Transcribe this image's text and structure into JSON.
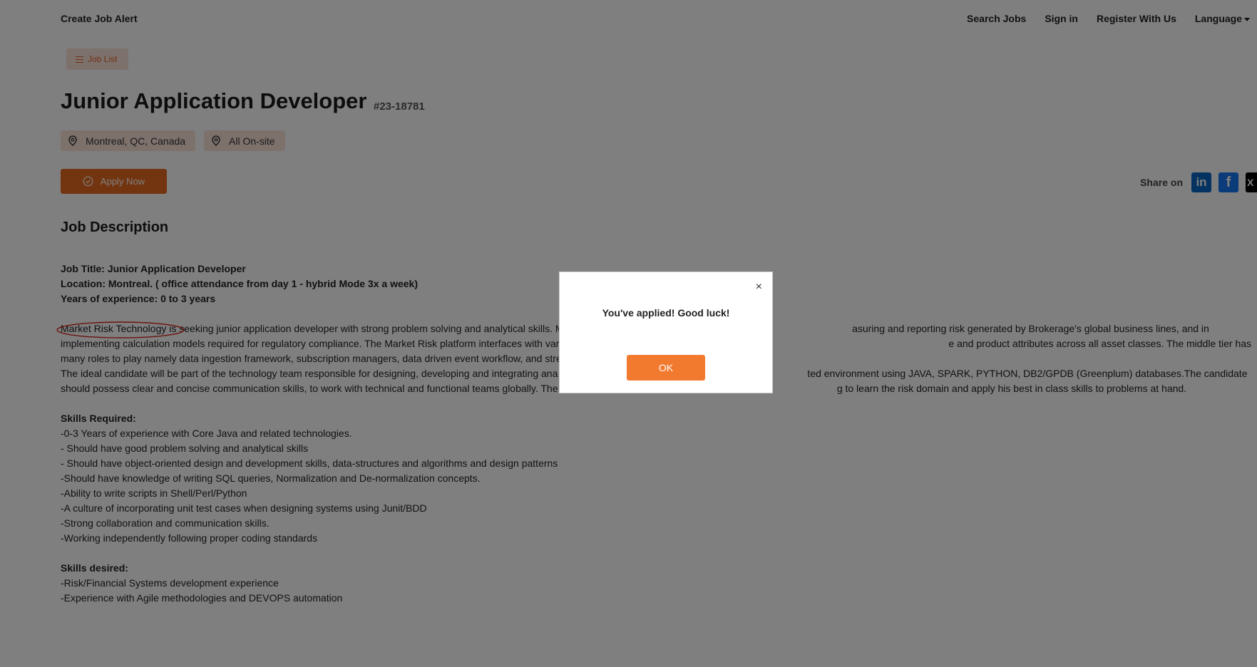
{
  "nav": {
    "create_alert": "Create Job Alert",
    "items": [
      "Search Jobs",
      "Sign in",
      "Register With Us",
      "Language"
    ]
  },
  "job_list_label": "Job List",
  "job": {
    "title": "Junior Application Developer",
    "id": "#23-18781",
    "location": "Montreal, QC, Canada",
    "work_mode": "All On-site",
    "apply_label": "Apply Now"
  },
  "share_label": "Share on",
  "social": {
    "linkedin": "in",
    "facebook": "f",
    "x": "X"
  },
  "section_title": "Job Description",
  "description": {
    "title_line": "Job Title: Junior Application Developer",
    "location_line": "Location: Montreal. ( office attendance from day 1 - hybrid Mode 3x a week)",
    "experience_line": "Years of experience: 0 to 3 years",
    "para1_circled": "Market Risk Technology",
    "para1_rest": " is seeking junior application developer with strong problem solving and analytical skills. M                                                                                                        asuring and reporting risk generated by Brokerage's global business lines, and in implementing calculation models required for regulatory compliance. The Market Risk platform interfaces with various systems and obtains                                                                                                    e and product attributes across all asset classes. The middle tier has many roles to play namely data ingestion framework, subscription managers, data driven event workflow, and streaming dynamic datasets over the wire.",
    "para2": "The ideal candidate will be part of the technology team responsible for designing, developing and integrating ana                                                                                          ted environment using JAVA, SPARK, PYTHON, DB2/GPDB (Greenplum) databases.The candidate should possess clear and concise communication skills, to work with technical and functional teams globally. The candid                                                                                         g to learn the risk domain and apply his best in class skills to problems at hand.",
    "skills_required_heading": "Skills Required:",
    "skills_required": [
      "-0-3 Years of experience with Core Java and related technologies.",
      "- Should have good problem solving and analytical skills",
      "- Should have object-oriented design and development skills, data-structures and algorithms and design patterns",
      "-Should have knowledge of writing SQL queries, Normalization and De-normalization concepts.",
      "-Ability to write scripts in Shell/Perl/Python",
      "-A culture of incorporating unit test cases when designing systems using Junit/BDD",
      "-Strong collaboration and communication skills.",
      "-Working independently following proper coding standards"
    ],
    "skills_desired_heading": "Skills desired:",
    "skills_desired": [
      "-Risk/Financial Systems development experience",
      "-Experience with Agile methodologies and DEVOPS automation"
    ]
  },
  "modal": {
    "close": "×",
    "message": "You've applied! Good luck!",
    "ok_label": "OK"
  },
  "colors": {
    "accent": "#e66a1f",
    "tag_bg": "#fbe3d8",
    "overlay": "rgba(0,0,0,0.5)",
    "annotation": "#d9261c"
  }
}
